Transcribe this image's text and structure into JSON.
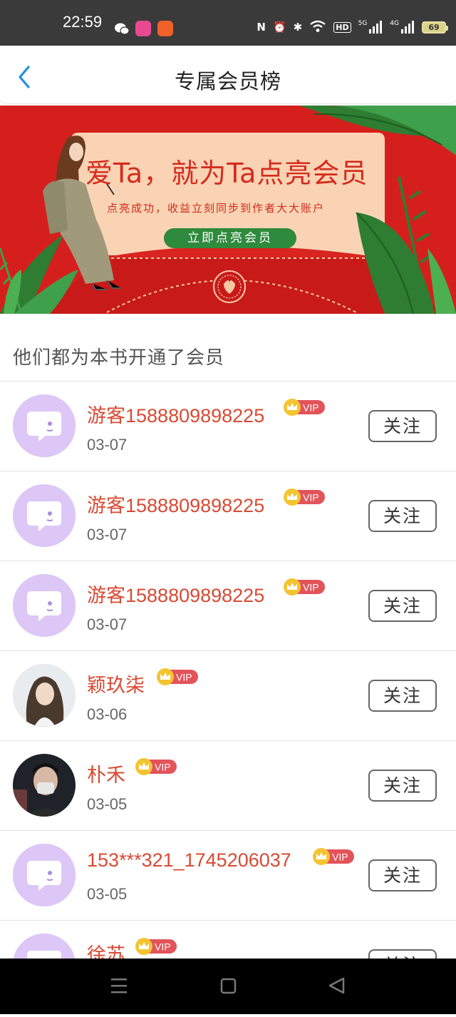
{
  "status_bar": {
    "time": "22:59",
    "battery": "69",
    "icons": [
      "wechat-icon",
      "app-pink-icon",
      "app-orange-icon",
      "nfc-icon",
      "alarm-icon",
      "bluetooth-icon",
      "wifi-icon",
      "hd-icon",
      "signal-5g-icon",
      "signal-4g-icon",
      "battery-icon"
    ],
    "hd_label": "HD",
    "net1": "5G",
    "net2": "4G"
  },
  "header": {
    "title": "专属会员榜"
  },
  "banner": {
    "title": "爱Ta，就为Ta点亮会员",
    "subtitle": "点亮成功，收益立刻同步到作者大大账户",
    "button_label": "立即点亮会员",
    "colors": {
      "background": "#d7201d",
      "card": "#f9d3b4",
      "button": "#2e8a3c"
    }
  },
  "section": {
    "title": "他们都为本书开通了会员"
  },
  "vip_label": "VIP",
  "follow_label": "关注",
  "members": [
    {
      "name": "游客1588809898225",
      "date": "03-07",
      "avatar": "default"
    },
    {
      "name": "游客1588809898225",
      "date": "03-07",
      "avatar": "default"
    },
    {
      "name": "游客1588809898225",
      "date": "03-07",
      "avatar": "default"
    },
    {
      "name": "颖玖柒",
      "date": "03-06",
      "avatar": "photo-woman"
    },
    {
      "name": "朴禾",
      "date": "03-05",
      "avatar": "photo-man"
    },
    {
      "name": "153***321_1745206037",
      "date": "03-05",
      "avatar": "default"
    },
    {
      "name": "徐苏",
      "date": "",
      "avatar": "default"
    }
  ],
  "colors": {
    "name": "#d94a33",
    "vip": "#e2545a",
    "crown": "#f4c430",
    "avatar_default": "#dcc7f6"
  }
}
